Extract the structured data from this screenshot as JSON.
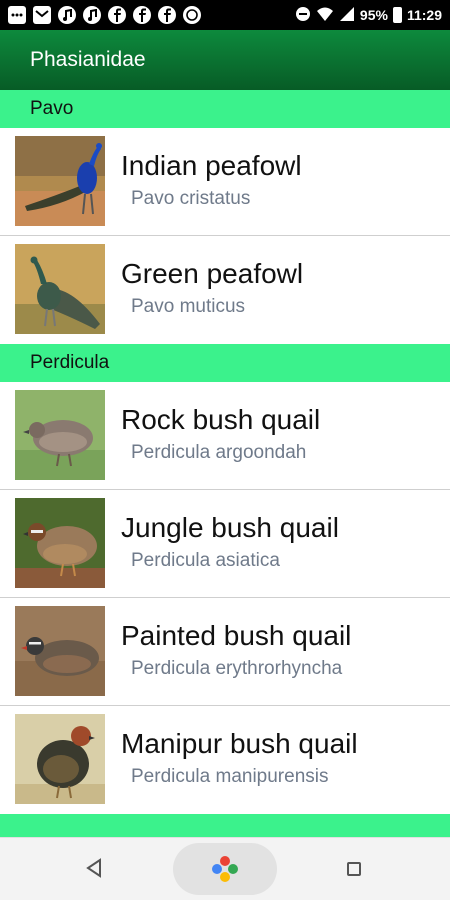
{
  "status_bar": {
    "battery": "95%",
    "time": "11:29",
    "icons": [
      "chat-icon",
      "mail-icon",
      "music-icon",
      "music-icon",
      "facebook-icon",
      "facebook-icon",
      "facebook-icon",
      "whatsapp-icon"
    ]
  },
  "app_bar": {
    "title": "Phasianidae",
    "color": "#0a6e2f"
  },
  "sections": [
    {
      "name": "Pavo",
      "birds": [
        {
          "common": "Indian peafowl",
          "scientific": "Pavo cristatus"
        },
        {
          "common": "Green peafowl",
          "scientific": "Pavo muticus"
        }
      ]
    },
    {
      "name": "Perdicula",
      "birds": [
        {
          "common": "Rock bush quail",
          "scientific": "Perdicula argoondah"
        },
        {
          "common": "Jungle bush quail",
          "scientific": "Perdicula asiatica"
        },
        {
          "common": "Painted bush quail",
          "scientific": "Perdicula erythrorhyncha"
        },
        {
          "common": "Manipur bush quail",
          "scientific": "Perdicula manipurensis"
        }
      ]
    }
  ],
  "colors": {
    "section_header": "#3bf28c",
    "scientific_text": "#6f7a8a"
  },
  "nav_bar": {
    "back_icon": "back-triangle-icon",
    "home_icon": "google-assistant-icon",
    "recents_icon": "recents-square-icon"
  }
}
